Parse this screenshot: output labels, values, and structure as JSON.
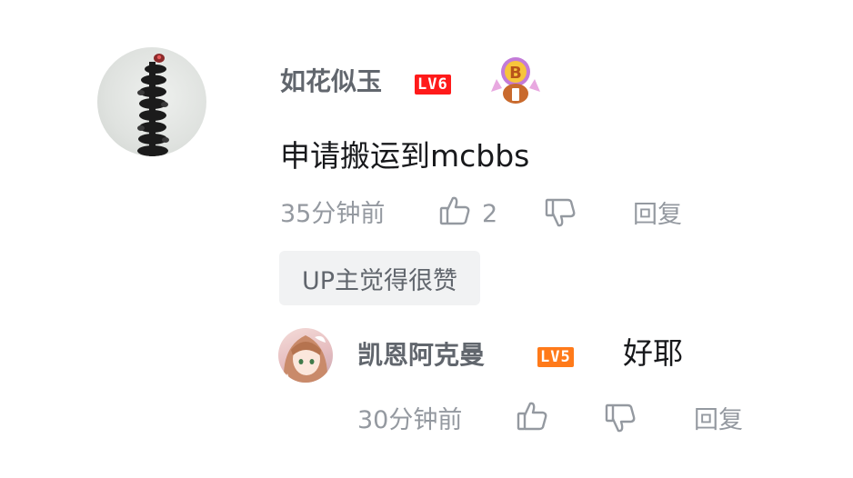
{
  "comment": {
    "username": "如花似玉",
    "level_badge": "LV6",
    "content": "申请搬运到mcbbs",
    "time": "35分钟前",
    "like_count": "2",
    "reply_label": "回复",
    "up_liked_tag": "UP主觉得很赞",
    "icons": {
      "vip": "vip-medal-icon",
      "like": "thumbs-up-icon",
      "dislike": "thumbs-down-icon"
    }
  },
  "reply": {
    "username": "凯恩阿克曼",
    "level_badge": "LV5",
    "content": "好耶",
    "time": "30分钟前",
    "reply_label": "回复"
  },
  "colors": {
    "username": "#61666d",
    "content": "#18191c",
    "meta": "#9499a0",
    "lv6": "#ff1a1a",
    "lv5": "#ff7a1a",
    "tag_bg": "#f1f2f3"
  }
}
